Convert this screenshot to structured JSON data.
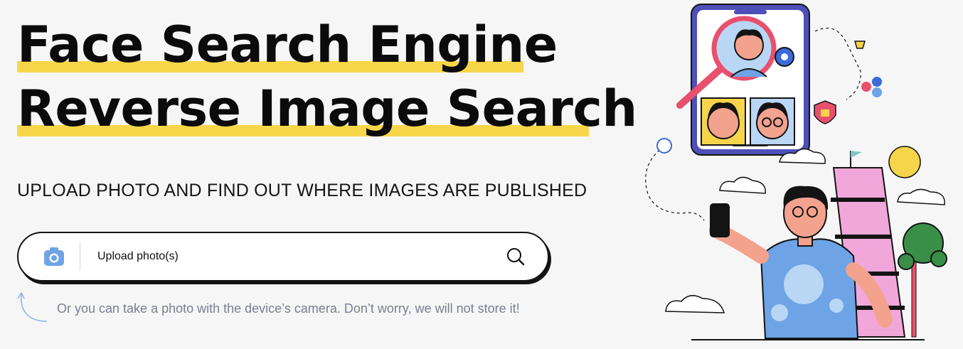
{
  "hero": {
    "title_line1": "Face Search Engine",
    "title_line2": "Reverse Image Search",
    "subtitle": "UPLOAD PHOTO AND FIND OUT WHERE IMAGES ARE PUBLISHED"
  },
  "upload": {
    "label": "Upload photo(s)",
    "camera_icon": "camera-icon",
    "search_icon": "search-icon"
  },
  "hint": {
    "text": "Or you can take a photo with the device’s camera. Don’t worry, we will not store it!",
    "icon": "curved-arrow-icon"
  },
  "colors": {
    "highlight": "#f8d649",
    "accent_blue": "#6ea3e6",
    "hint_text": "#7a7f91"
  },
  "illustration": {
    "icon": "face-search-illustration"
  }
}
